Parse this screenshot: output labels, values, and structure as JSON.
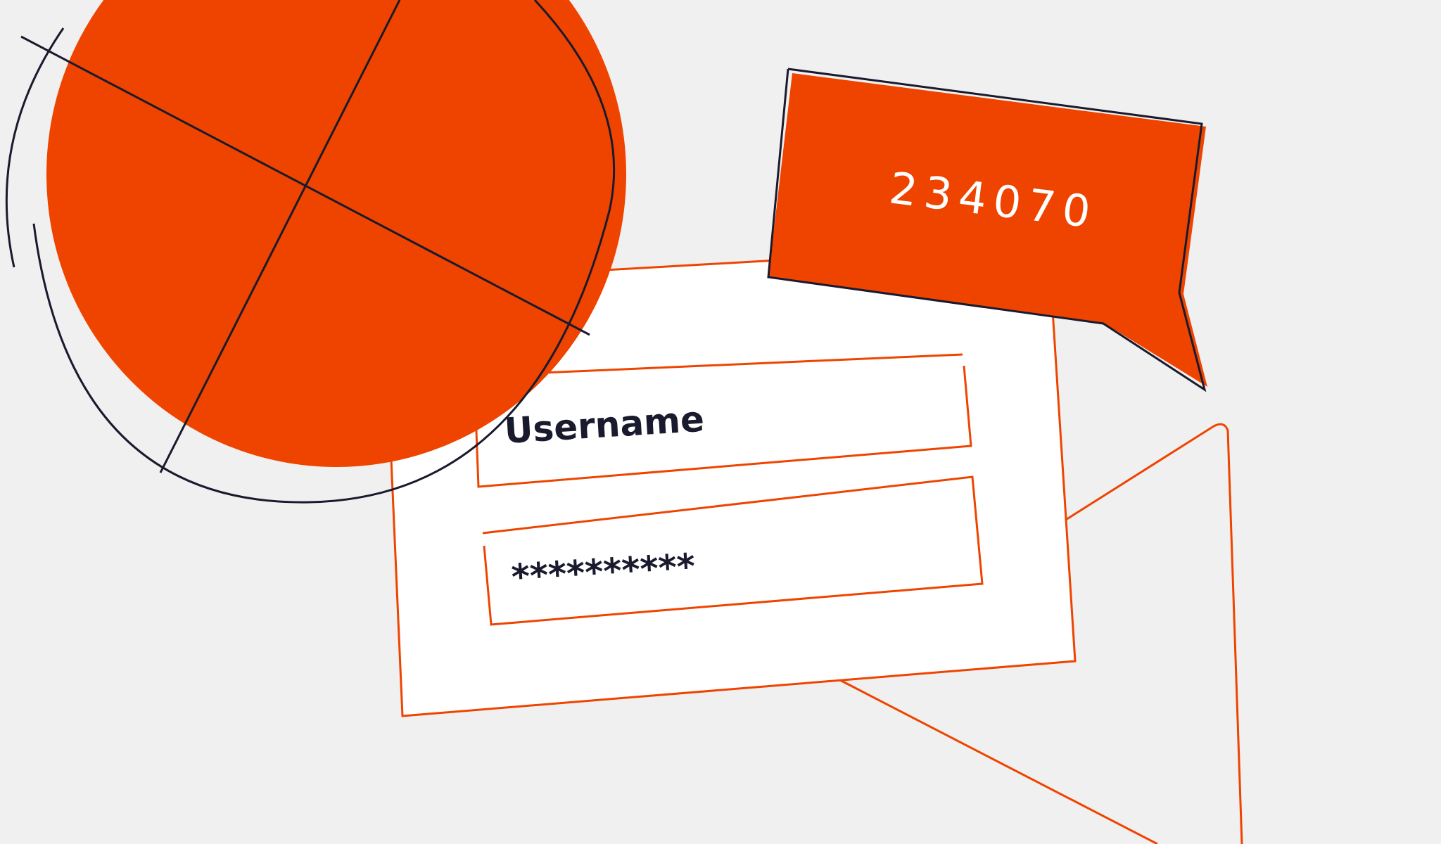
{
  "login_form": {
    "username_value": "Username",
    "password_value": "**********"
  },
  "otp_bubble": {
    "code": "234070"
  },
  "colors": {
    "accent": "#ef4400",
    "ink": "#1a1a2e",
    "card": "#ffffff",
    "background": "#f0f0f0"
  }
}
